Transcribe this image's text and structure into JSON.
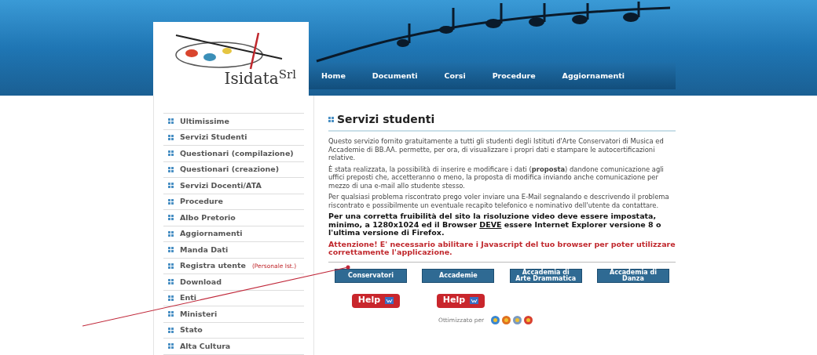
{
  "logo": {
    "text": "Isidata$^{Srl}$"
  },
  "nav": [
    {
      "label": "Home"
    },
    {
      "label": "Documenti"
    },
    {
      "label": "Corsi"
    },
    {
      "label": "Procedure"
    },
    {
      "label": "Aggiornamenti"
    }
  ],
  "sidebar": {
    "items": [
      {
        "label": "Ultimissime"
      },
      {
        "label": "Servizi Studenti"
      },
      {
        "label": "Questionari (compilazione)"
      },
      {
        "label": "Questionari (creazione)"
      },
      {
        "label": "Servizi Docenti/ATA"
      },
      {
        "label": "Procedure"
      },
      {
        "label": "Albo Pretorio"
      },
      {
        "label": "Aggiornamenti"
      },
      {
        "label": "Manda Dati"
      },
      {
        "label": "Registra utente",
        "note": "(Personale Ist.)"
      },
      {
        "label": "Download"
      },
      {
        "label": "Enti"
      },
      {
        "label": "Ministeri"
      },
      {
        "label": "Stato"
      },
      {
        "label": "Alta Cultura"
      }
    ]
  },
  "content": {
    "title": "Servizi studenti",
    "paragraphs": [
      {
        "kind": "normal",
        "segments": [
          {
            "text": "Questo servizio fornito gratuitamente a tutti gli studenti degli Istituti d'Arte Conservatori di Musica ed Accademie di BB.AA. permette, per ora, di visualizzare i propri dati e stampare le autocertificazioni relative.",
            "underline": false
          }
        ]
      },
      {
        "kind": "normal",
        "segments": [
          {
            "text": "È stata realizzata, la possibilità di inserire e modificare i dati (**proposta**) dandone comunicazione agli uffici preposti che, accetteranno o meno, la proposta di modifica inviando anche comunicazione per mezzo di una e-mail allo studente stesso.",
            "underline": false
          }
        ]
      },
      {
        "kind": "normal",
        "segments": [
          {
            "text": "Per qualsiasi problema riscontrato prego voler inviare una E-Mail segnalando e descrivendo il problema riscontrato e possibilmente un eventuale recapito telefonico e nominativo dell'utente da contattare.",
            "underline": false
          }
        ]
      },
      {
        "kind": "notice",
        "segments": [
          {
            "text": "Per una corretta fruibilità del sito la risoluzione video deve essere impostata, minimo, a 1280x1024 ed il Browser ",
            "underline": false
          },
          {
            "text": "DEVE",
            "underline": true
          },
          {
            "text": " essere Internet Explorer versione 8 o l'ultima versione di Firefox.",
            "underline": false
          }
        ]
      },
      {
        "kind": "warning",
        "segments": [
          {
            "text": "Attenzione! E' necessario abilitare i Javascript del tuo browser per poter utilizzare correttamente l'applicazione.",
            "underline": false
          }
        ]
      }
    ],
    "buttons": [
      {
        "lines": [
          "Conservatori"
        ]
      },
      {
        "lines": [
          "Accademie"
        ]
      },
      {
        "lines": [
          "Accademia di",
          "Arte Drammatica"
        ]
      },
      {
        "lines": [
          "Accademia di",
          "Danza"
        ]
      }
    ],
    "help_buttons": [
      {
        "label": "Help"
      },
      {
        "label": "Help"
      }
    ],
    "optimized": {
      "label": "Ottimizzato per"
    }
  }
}
